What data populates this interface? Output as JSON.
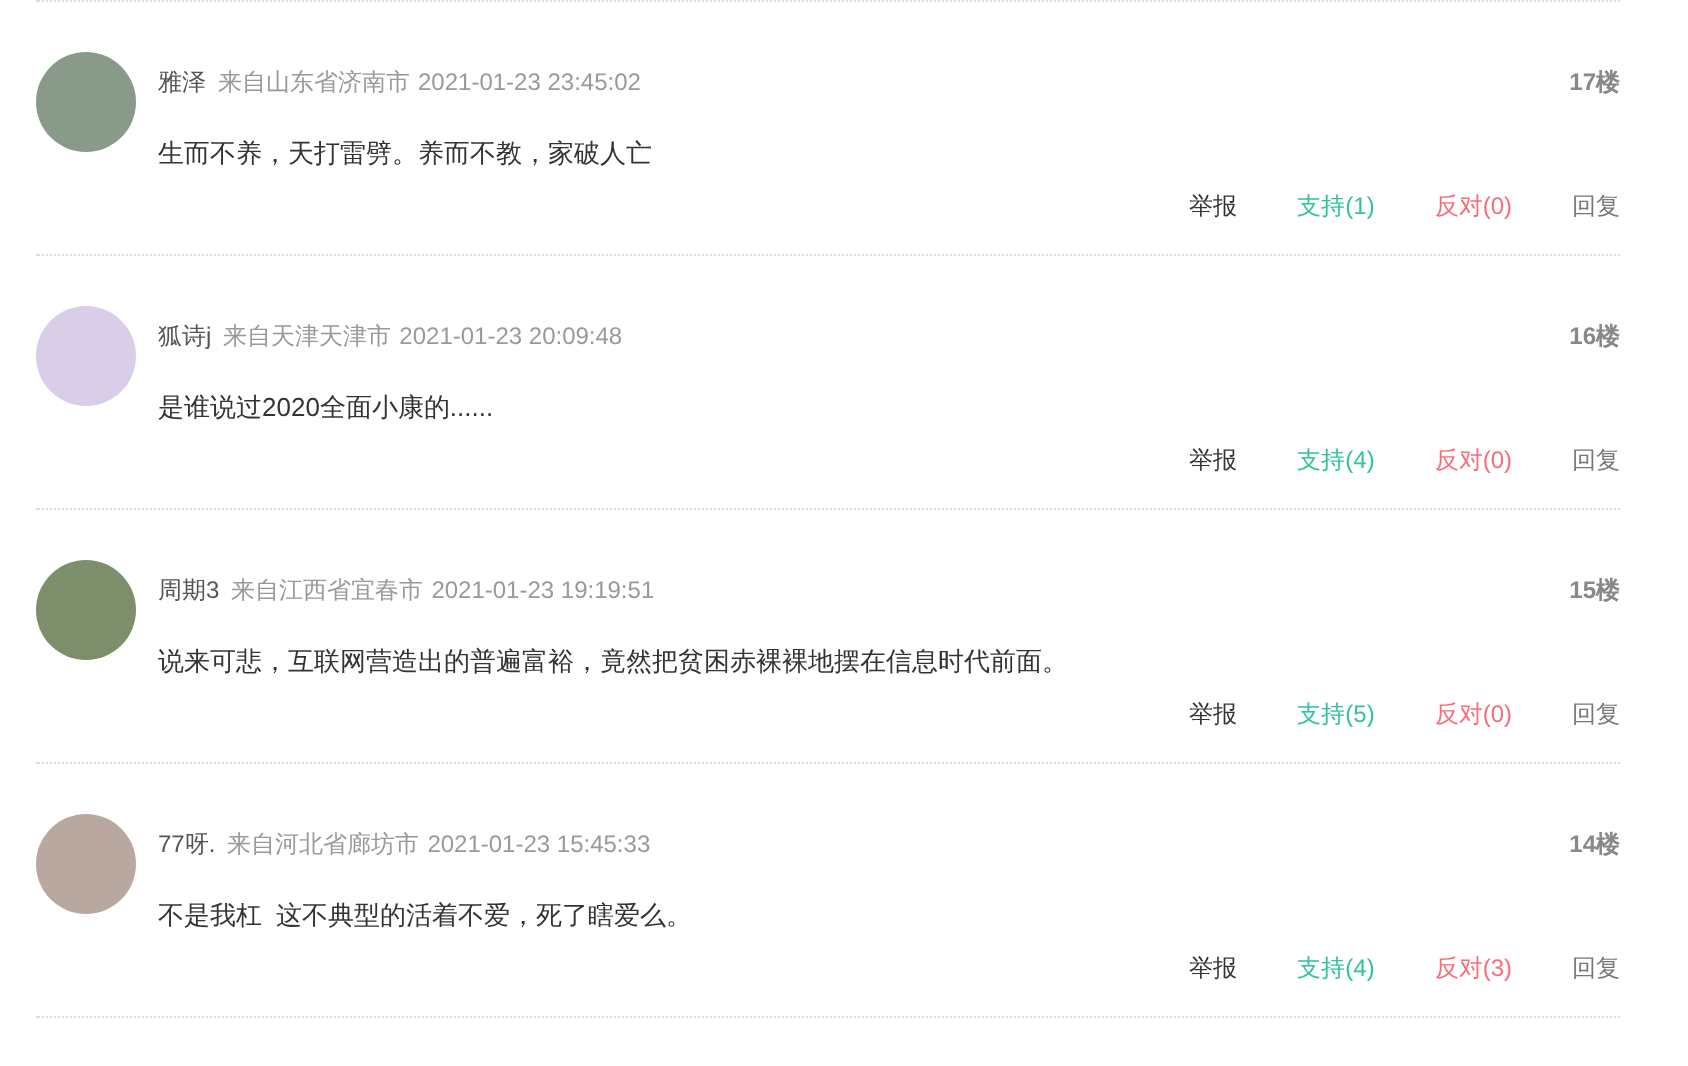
{
  "comments": [
    {
      "user": "雅泽",
      "location": "来自山东省济南市",
      "time": "2021-01-23 23:45:02",
      "floor": "17楼",
      "content": "生而不养，天打雷劈。养而不教，家破人亡",
      "report": "举报",
      "support": "支持(1)",
      "oppose": "反对(0)",
      "reply": "回复"
    },
    {
      "user": "狐诗j",
      "location": "来自天津天津市",
      "time": "2021-01-23 20:09:48",
      "floor": "16楼",
      "content": "是谁说过2020全面小康的......",
      "report": "举报",
      "support": "支持(4)",
      "oppose": "反对(0)",
      "reply": "回复"
    },
    {
      "user": "周期3",
      "location": "来自江西省宜春市",
      "time": "2021-01-23 19:19:51",
      "floor": "15楼",
      "content": "说来可悲，互联网营造出的普遍富裕，竟然把贫困赤裸裸地摆在信息时代前面。",
      "report": "举报",
      "support": "支持(5)",
      "oppose": "反对(0)",
      "reply": "回复"
    },
    {
      "user": "77呀.",
      "location": "来自河北省廊坊市",
      "time": "2021-01-23 15:45:33",
      "floor": "14楼",
      "content": "不是我杠  这不典型的活着不爱，死了瞎爱么。",
      "report": "举报",
      "support": "支持(4)",
      "oppose": "反对(3)",
      "reply": "回复"
    }
  ]
}
